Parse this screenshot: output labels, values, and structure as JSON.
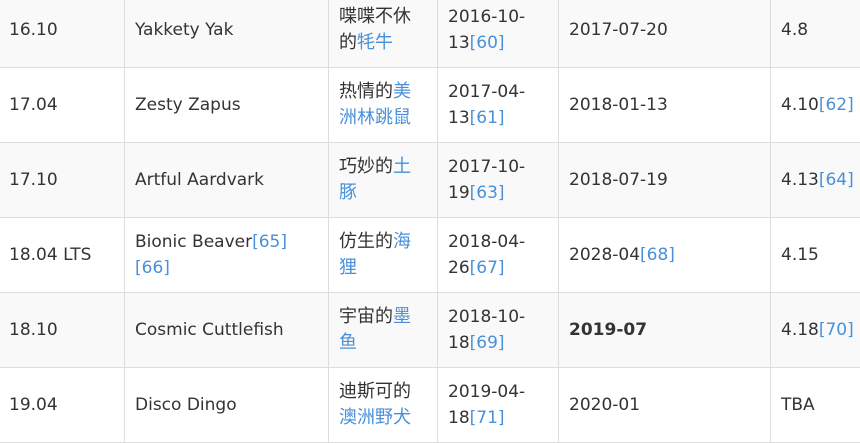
{
  "rows": [
    {
      "version": "16.10",
      "codename": "Yakkety Yak",
      "codename_refs": "",
      "zh_plain": "喋喋不休的",
      "zh_link": "牦牛",
      "release": "2016-10-13",
      "release_ref": "[60]",
      "eol": "2017-07-20",
      "eol_ref": "",
      "eol_bold": false,
      "kernel": "4.8",
      "kernel_ref": ""
    },
    {
      "version": "17.04",
      "codename": "Zesty Zapus",
      "codename_refs": "",
      "zh_plain": "热情的",
      "zh_link": "美洲林跳鼠",
      "release": "2017-04-13",
      "release_ref": "[61]",
      "eol": "2018-01-13",
      "eol_ref": "",
      "eol_bold": false,
      "kernel": "4.10",
      "kernel_ref": "[62]"
    },
    {
      "version": "17.10",
      "codename": "Artful Aardvark",
      "codename_refs": "",
      "zh_plain": "巧妙的",
      "zh_link": "土豚",
      "release": "2017-10-19",
      "release_ref": "[63]",
      "eol": "2018-07-19",
      "eol_ref": "",
      "eol_bold": false,
      "kernel": "4.13",
      "kernel_ref": "[64]"
    },
    {
      "version": "18.04 LTS",
      "codename": "Bionic Beaver",
      "codename_refs": "[65][66]",
      "zh_plain": "仿生的",
      "zh_link": "海狸",
      "release": "2018-04-26",
      "release_ref": "[67]",
      "eol": "2028-04",
      "eol_ref": "[68]",
      "eol_bold": false,
      "kernel": "4.15",
      "kernel_ref": ""
    },
    {
      "version": "18.10",
      "codename": "Cosmic Cuttlefish",
      "codename_refs": "",
      "zh_plain": "宇宙的",
      "zh_link": "墨鱼",
      "release": "2018-10-18",
      "release_ref": "[69]",
      "eol": "2019-07",
      "eol_ref": "",
      "eol_bold": true,
      "kernel": "4.18",
      "kernel_ref": "[70]"
    },
    {
      "version": "19.04",
      "codename": "Disco Dingo",
      "codename_refs": "",
      "zh_plain": "迪斯可的",
      "zh_link": "澳洲野犬",
      "release": "2019-04-18",
      "release_ref": "[71]",
      "eol": "2020-01",
      "eol_ref": "",
      "eol_bold": false,
      "kernel": "TBA",
      "kernel_ref": ""
    }
  ]
}
